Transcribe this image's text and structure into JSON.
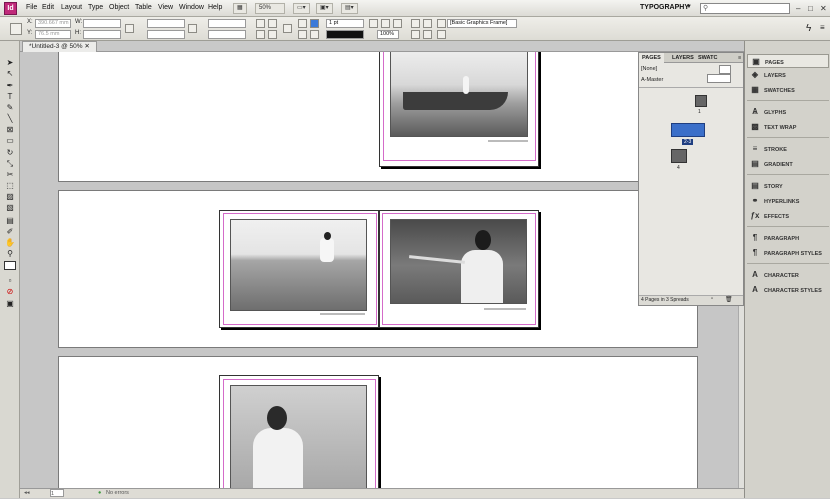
{
  "menubar": {
    "logo": "Id",
    "items": [
      "File",
      "Edit",
      "Layout",
      "Type",
      "Object",
      "Table",
      "View",
      "Window",
      "Help"
    ],
    "zoom": "50%",
    "workspace": "TYPOGRAPHY"
  },
  "control": {
    "x_value": "390.667 mm",
    "y_value": "76.5 mm",
    "stroke_weight": "1 pt",
    "opacity": "100%",
    "frame_style": "[Basic Graphics Frame]"
  },
  "document": {
    "tab_title": "*Untitled-3 @ 50%"
  },
  "pages_panel": {
    "tabs": [
      "PAGES",
      "LAYERS",
      "SWATC"
    ],
    "masters": [
      "[None]",
      "A-Master"
    ],
    "page_labels": [
      "1",
      "2-3",
      "4"
    ],
    "footer": "4 Pages in 3 Spreads"
  },
  "dock": {
    "groups": [
      [
        "PAGES",
        "LAYERS",
        "SWATCHES"
      ],
      [
        "GLYPHS",
        "TEXT WRAP"
      ],
      [
        "STROKE",
        "GRADIENT"
      ],
      [
        "STORY",
        "HYPERLINKS",
        "EFFECTS"
      ],
      [
        "PARAGRAPH",
        "PARAGRAPH STYLES"
      ],
      [
        "CHARACTER",
        "CHARACTER STYLES"
      ]
    ]
  },
  "status": {
    "page": "1",
    "errors": "No errors"
  }
}
